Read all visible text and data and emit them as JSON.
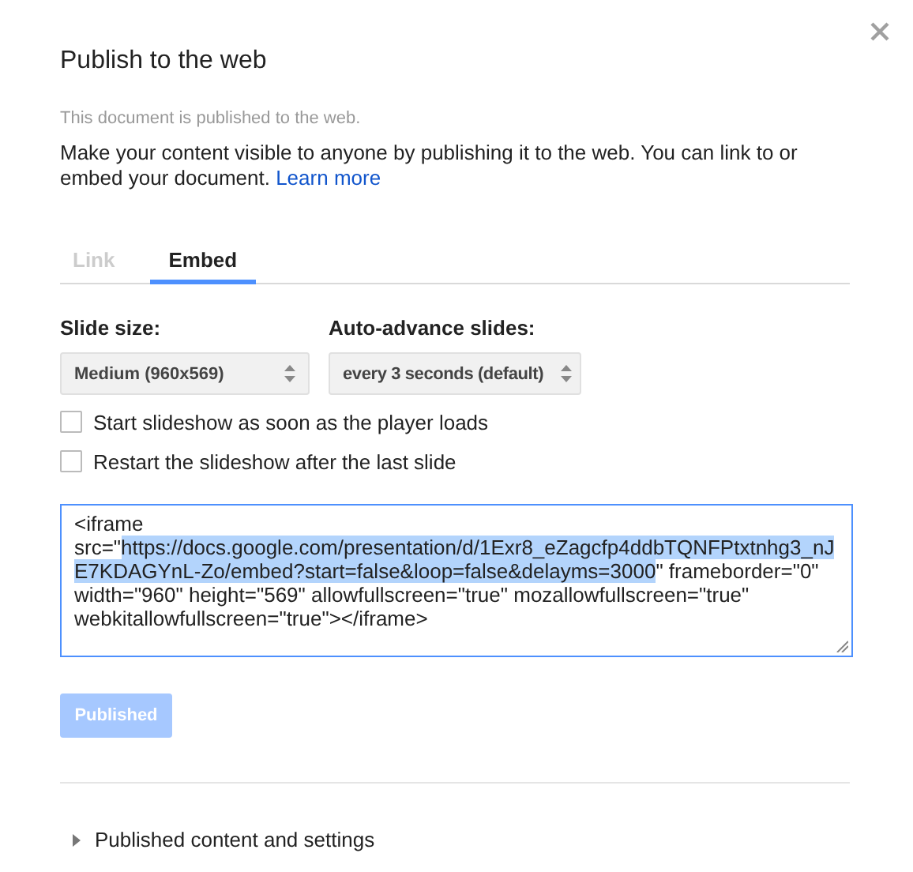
{
  "dialog": {
    "title": "Publish to the web",
    "status": "This document is published to the web.",
    "description": "Make your content visible to anyone by publishing it to the web. You can link to or embed your document.",
    "learn_more": "Learn more"
  },
  "tabs": [
    {
      "label": "Link",
      "selected": false
    },
    {
      "label": "Embed",
      "selected": true
    }
  ],
  "selects": [
    {
      "label": "Slide size:",
      "value": "Medium (960x569)"
    },
    {
      "label": "Auto-advance slides:",
      "value": "every 3 seconds (default)"
    }
  ],
  "options": [
    {
      "label": "Start slideshow as soon as the player loads",
      "checked": false
    },
    {
      "label": "Restart the slideshow after the last slide",
      "checked": false
    }
  ],
  "embed_code": {
    "before": "<iframe src=\"",
    "selected_text": "https://docs.google.com/presentation/d/1Exr8_eZagcfp4ddbTQNFPtxtnhg3_nJE7KDAGYnL-Zo/embed?start=false&loop=false&delayms=3000",
    "after": "\" frameborder=\"0\" width=\"960\" height=\"569\" allowfullscreen=\"true\" mozallowfullscreen=\"true\" webkitallowfullscreen=\"true\"></iframe>"
  },
  "publish_button": {
    "label": "Published",
    "disabled": true
  },
  "section": {
    "label": "Published content and settings",
    "expanded": false
  }
}
